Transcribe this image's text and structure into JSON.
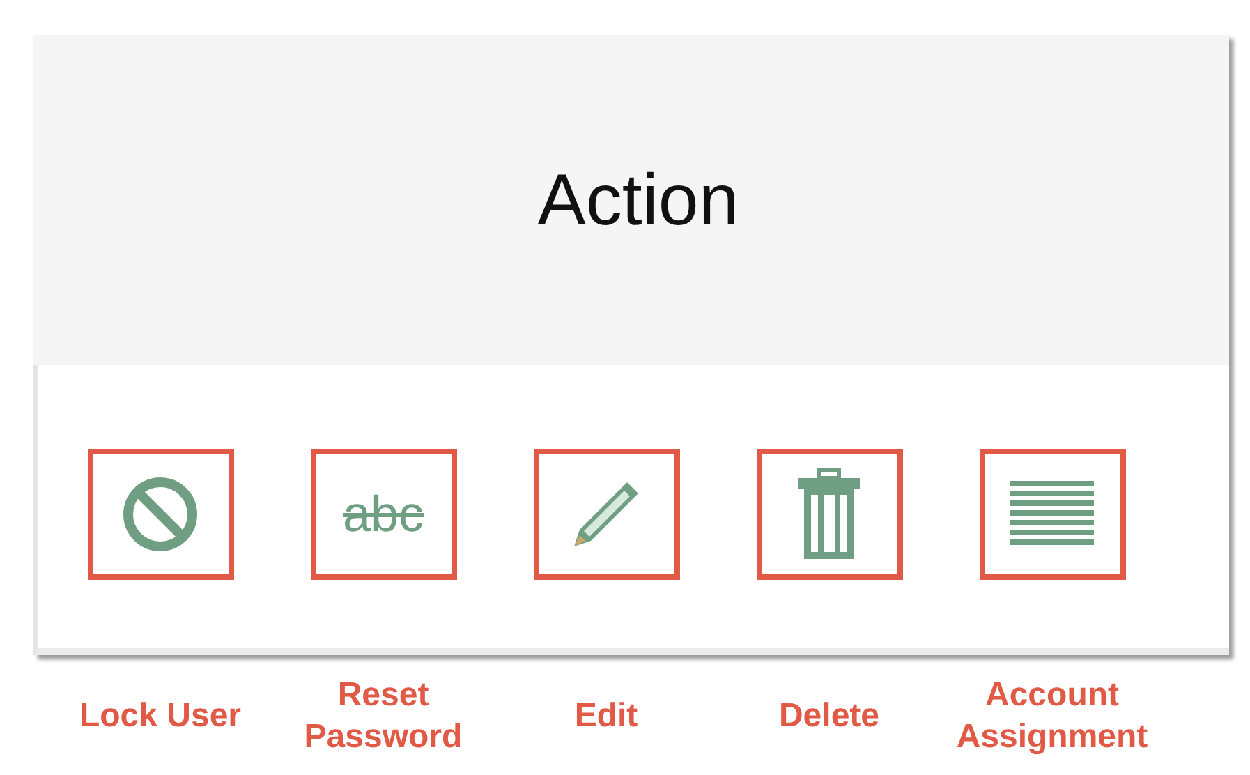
{
  "table": {
    "columns": [
      {
        "header": "Action"
      }
    ],
    "actions": [
      {
        "kind": "ban"
      },
      {
        "kind": "text",
        "glyph": "abc"
      },
      {
        "kind": "pencil"
      },
      {
        "kind": "trash"
      },
      {
        "kind": "lines"
      }
    ]
  },
  "annotations": [
    {
      "label": "Lock User"
    },
    {
      "label": "Reset Password"
    },
    {
      "label": "Edit"
    },
    {
      "label": "Delete"
    },
    {
      "label": "Account Assignment"
    }
  ]
}
